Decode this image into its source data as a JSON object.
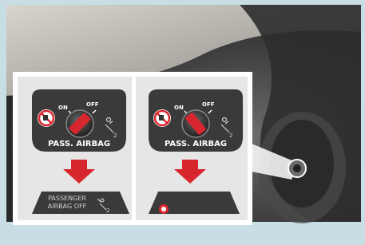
{
  "panels": [
    {
      "id": "left",
      "switch": {
        "on_label": "ON",
        "off_label": "OFF",
        "plate_label": "PASS. AIRBAG",
        "knob_position": "off"
      },
      "indicator": {
        "line1": "PASSENGER",
        "line2": "AIRBAG  OFF",
        "icon": "passenger-airbag-off-icon",
        "lit": false
      }
    },
    {
      "id": "right",
      "switch": {
        "on_label": "ON",
        "off_label": "OFF",
        "plate_label": "PASS. AIRBAG",
        "knob_position": "on"
      },
      "indicator": {
        "icon": "airbag-on-warning-icon",
        "lit": true
      }
    }
  ],
  "colors": {
    "frame": "#c9dde4",
    "arrow": "#d8262e",
    "plate": "#3a3a3a",
    "warning": "#d8262e"
  }
}
